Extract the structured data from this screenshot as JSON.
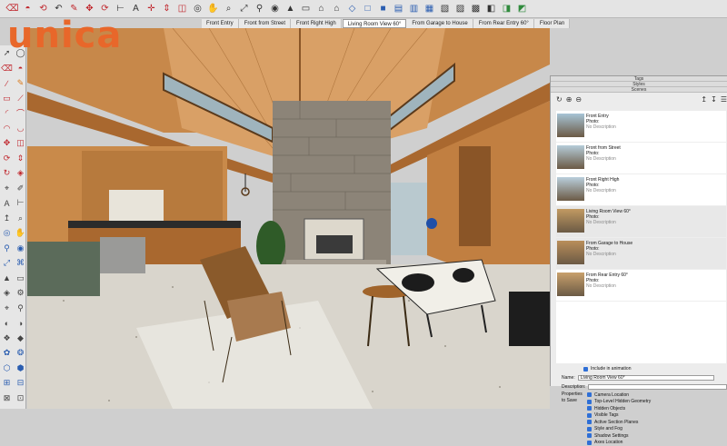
{
  "logo": {
    "text": "unica"
  },
  "toolbar": {
    "icons": [
      "eraser-icon",
      "paint-bucket-icon",
      "lasso-icon",
      "undo-icon",
      "pencil-icon",
      "arrows-move-icon",
      "rotate-icon",
      "tape-icon",
      "text-icon",
      "axes-icon",
      "push-pull-icon",
      "offset-icon",
      "orbit-icon",
      "pan-icon",
      "zoom-icon",
      "zoom-extents-icon",
      "walk-icon",
      "look-around-icon",
      "position-camera-icon",
      "section-plane-icon",
      "home-icon",
      "house-icon",
      "iso-view-icon",
      "top-view-icon",
      "front-view-icon",
      "right-view-icon",
      "back-view-icon",
      "left-view-icon",
      "xray-icon",
      "wireframe-icon",
      "hidden-line-icon",
      "shaded-icon",
      "textured-icon",
      "monochrome-icon"
    ]
  },
  "scene_tabs": [
    {
      "label": "Front Entry",
      "active": false
    },
    {
      "label": "Front from Street",
      "active": false
    },
    {
      "label": "Front Right High",
      "active": false
    },
    {
      "label": "Living Room View 60°",
      "active": true
    },
    {
      "label": "From Garage to House",
      "active": false
    },
    {
      "label": "From Rear Entry 60°",
      "active": false
    },
    {
      "label": "Floor Plan",
      "active": false
    }
  ],
  "panel": {
    "tags_header": "Tags",
    "styles_header": "Styles",
    "scenes_header": "Scenes",
    "scenes": [
      {
        "name": "Front Entry",
        "photo_label": "Photo:",
        "description": "No Description",
        "active": false,
        "thumb_color": "#a7c4d6"
      },
      {
        "name": "Front from Street",
        "photo_label": "Photo:",
        "description": "No Description",
        "active": false,
        "thumb_color": "#b5ccd9"
      },
      {
        "name": "Front Right High",
        "photo_label": "Photo:",
        "description": "No Description",
        "active": false,
        "thumb_color": "#b9cfdc"
      },
      {
        "name": "Living Room View 60°",
        "photo_label": "Photo:",
        "description": "No Description",
        "active": true,
        "thumb_color": "#c29a62"
      },
      {
        "name": "From Garage to House",
        "photo_label": "Photo:",
        "description": "No Description",
        "active": true,
        "thumb_color": "#b98e5a"
      },
      {
        "name": "From Rear Entry 60°",
        "photo_label": "Photo:",
        "description": "No Description",
        "active": false,
        "thumb_color": "#c8a06c"
      }
    ],
    "include_animation_label": "Include in animation",
    "name_label": "Name:",
    "name_value": "Living Room View 60°",
    "description_label": "Description:",
    "properties_label_1": "Properties",
    "properties_label_2": "to Save",
    "properties": [
      "Camera Location",
      "Top-Level Hidden Geometry",
      "Hidden Objects",
      "Visible Tags",
      "Active Section Planes",
      "Style and Fog",
      "Shadow Settings",
      "Axes Location"
    ]
  },
  "colors": {
    "wood": "#c98a4a",
    "wood_dark": "#a9682f",
    "stone": "#8c8478",
    "floor": "#d9d5cc",
    "toolbar_bg": "#e4e4e4",
    "panel_bg": "#ececec",
    "checkbox_blue": "#2f6fd6",
    "logo_orange": "#e8672a",
    "logo_blue": "#2c3e8f"
  }
}
